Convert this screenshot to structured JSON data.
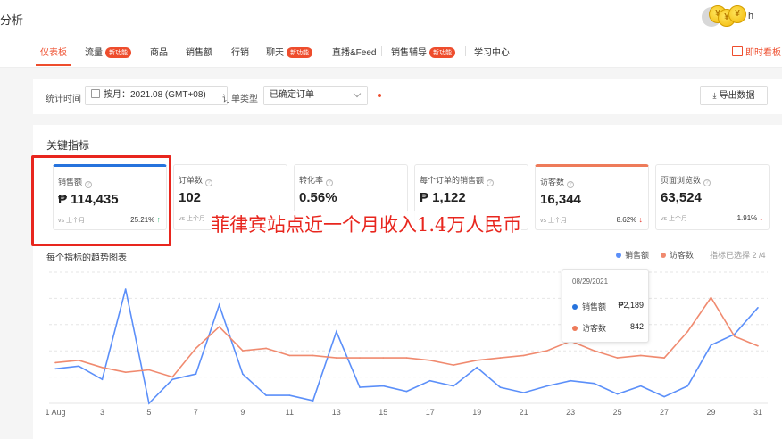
{
  "header": {
    "page_title": "分析",
    "user_name": "h",
    "coin_symbol": "¥"
  },
  "nav": {
    "items": [
      {
        "label": "仪表板",
        "badge": ""
      },
      {
        "label": "流量",
        "badge": "新功能"
      },
      {
        "label": "商品",
        "badge": ""
      },
      {
        "label": "销售额",
        "badge": ""
      },
      {
        "label": "行销",
        "badge": ""
      },
      {
        "label": "聊天",
        "badge": "新功能"
      },
      {
        "label": "直播&Feed",
        "badge": ""
      },
      {
        "label": "销售辅导",
        "badge": "新功能"
      },
      {
        "label": "学习中心",
        "badge": ""
      }
    ],
    "realtime_label": "即时看板"
  },
  "filters": {
    "period_label": "统计时间",
    "period_value": "按月：2021.08 (GMT+08)",
    "order_type_label": "订单类型",
    "order_type_value": "已确定订单",
    "export_label": "导出数据"
  },
  "key_metrics": {
    "section_title": "关键指标",
    "compare_label": "vs 上个月",
    "items": [
      {
        "label": "销售额",
        "value": "₱ 114,435",
        "change": "25.21%",
        "direction": "up"
      },
      {
        "label": "订单数",
        "value": "102",
        "change": "",
        "direction": ""
      },
      {
        "label": "转化率",
        "value": "0.56%",
        "change": "",
        "direction": ""
      },
      {
        "label": "每个订单的销售额",
        "value": "₱ 1,122",
        "change": "",
        "direction": ""
      },
      {
        "label": "访客数",
        "value": "16,344",
        "change": "8.62%",
        "direction": "down"
      },
      {
        "label": "页面浏览数",
        "value": "63,524",
        "change": "1.91%",
        "direction": "down"
      }
    ]
  },
  "overlay_caption": "菲律宾站点近一个月收入1.4万人民币",
  "chart_section": {
    "title": "每个指标的趋势图表",
    "legend_note": "指标已选择 2 /4"
  },
  "tooltip": {
    "date": "08/29/2021",
    "rows": [
      {
        "label": "销售额",
        "value": "₱2,189"
      },
      {
        "label": "访客数",
        "value": "842"
      }
    ]
  },
  "colors": {
    "accent": "#ee4d2d",
    "sales_series": "#5b8ff9",
    "visitors_series": "#f08a6f",
    "highlight": "#e8261e"
  },
  "chart_data": {
    "type": "line",
    "x": [
      "1 Aug",
      "2",
      "3",
      "4",
      "5",
      "6",
      "7",
      "8",
      "9",
      "10",
      "11",
      "12",
      "13",
      "14",
      "15",
      "16",
      "17",
      "18",
      "19",
      "20",
      "21",
      "22",
      "23",
      "24",
      "25",
      "26",
      "27",
      "28",
      "29",
      "30",
      "31"
    ],
    "x_tick_labels": [
      "1 Aug",
      "3",
      "5",
      "7",
      "9",
      "11",
      "13",
      "15",
      "17",
      "19",
      "21",
      "23",
      "25",
      "27",
      "29",
      "31"
    ],
    "series": [
      {
        "name": "销售额",
        "color": "#5b8ff9",
        "values": [
          1300,
          1400,
          900,
          4300,
          0,
          900,
          1100,
          3700,
          1100,
          300,
          300,
          100,
          2700,
          600,
          650,
          450,
          850,
          650,
          1350,
          600,
          400,
          650,
          850,
          750,
          350,
          650,
          250,
          650,
          2189,
          2600,
          3600
        ]
      },
      {
        "name": "访客数",
        "color": "#f08a6f",
        "values": [
          570,
          580,
          550,
          530,
          540,
          510,
          630,
          720,
          620,
          630,
          600,
          600,
          590,
          590,
          590,
          590,
          580,
          560,
          580,
          590,
          600,
          620,
          660,
          620,
          590,
          600,
          590,
          700,
          842,
          680,
          640
        ]
      }
    ],
    "grid": true
  }
}
